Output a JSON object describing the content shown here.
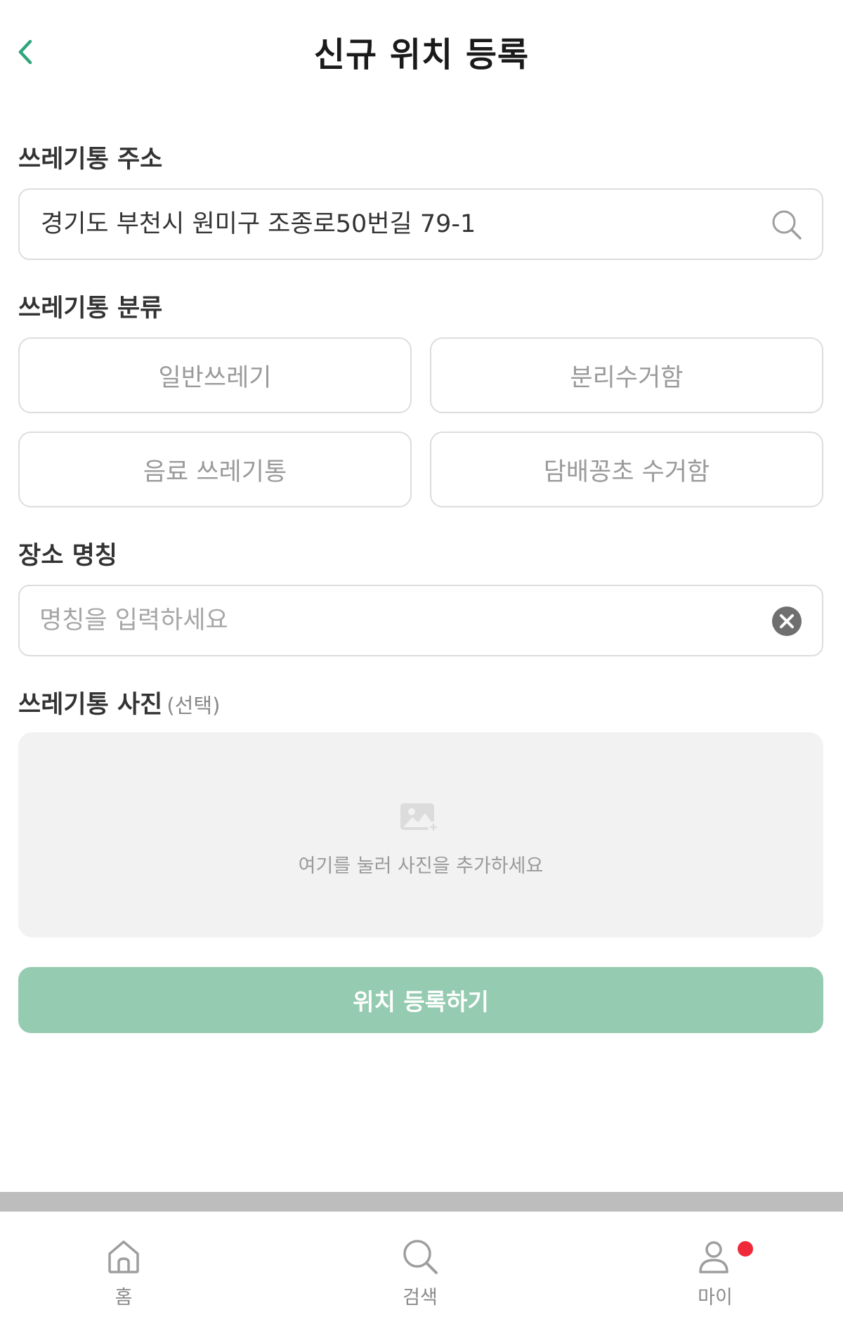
{
  "header": {
    "title": "신규 위치 등록",
    "back_icon": "chevron-left-icon"
  },
  "address": {
    "label": "쓰레기통 주소",
    "value": "경기도 부천시 원미구 조종로50번길 79-1",
    "icon": "search-icon"
  },
  "category": {
    "label": "쓰레기통 분류",
    "options": [
      "일반쓰레기",
      "분리수거함",
      "음료 쓰레기통",
      "담배꽁초 수거함"
    ]
  },
  "place_name": {
    "label": "장소 명칭",
    "value": "",
    "placeholder": "명칭을 입력하세요",
    "clear_icon": "clear-icon"
  },
  "photo": {
    "label": "쓰레기통 사진",
    "optional": "(선택)",
    "hint": "여기를 눌러 사진을 추가하세요",
    "icon": "add-photo-icon"
  },
  "submit": {
    "label": "위치 등록하기"
  },
  "bottom_nav": {
    "items": [
      {
        "label": "홈",
        "icon": "home-icon"
      },
      {
        "label": "검색",
        "icon": "search-icon"
      },
      {
        "label": "마이",
        "icon": "user-icon",
        "notification": true
      }
    ]
  },
  "colors": {
    "accent": "#2fa57a",
    "submit_bg": "#95cbb0",
    "border": "#dddddd",
    "photo_bg": "#f2f2f2",
    "notification": "#ee2a3a",
    "nav_divider": "#bdbdbd"
  }
}
